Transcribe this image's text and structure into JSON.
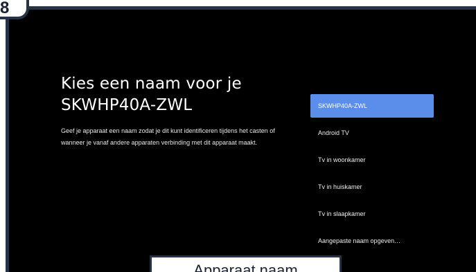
{
  "step": {
    "number": "8"
  },
  "screen": {
    "title_line1": "Kies een naam voor je",
    "title_line2": "SKWHP40A-ZWL",
    "description": "Geef je apparaat een naam zodat je dit kunt identificeren tijdens het casten of wanneer je vanaf andere apparaten verbinding met dit apparaat maakt.",
    "options": [
      {
        "label": "SKWHP40A-ZWL",
        "selected": true
      },
      {
        "label": "Android TV",
        "selected": false
      },
      {
        "label": "Tv in woonkamer",
        "selected": false
      },
      {
        "label": "Tv in huiskamer",
        "selected": false
      },
      {
        "label": "Tv in slaapkamer",
        "selected": false
      },
      {
        "label": "Aangepaste naam opgeven…",
        "selected": false
      }
    ]
  },
  "caption": {
    "text": "Apparaat naam"
  },
  "colors": {
    "selected_option": "#5b8dea",
    "frame": "#283246",
    "screen_background": "#000000"
  }
}
